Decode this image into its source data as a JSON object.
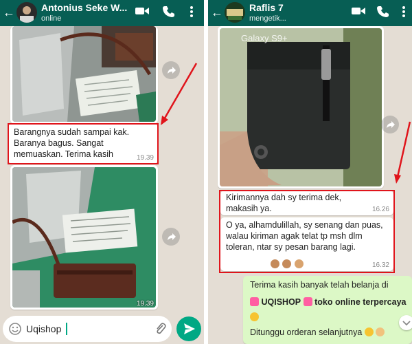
{
  "left_chat": {
    "contact_name": "Antonius Seke W...",
    "status": "online",
    "messages": [
      {
        "type": "image",
        "time": ""
      },
      {
        "type": "text",
        "text": "Barangnya sudah sampai kak. Baranya bagus. Sangat memuaskan. Terima kasih",
        "time": "19.39"
      },
      {
        "type": "image",
        "time": "19.39"
      }
    ],
    "composer_value": "Uqishop"
  },
  "right_chat": {
    "contact_name": "Raflis 7",
    "status": "mengetik...",
    "photo_watermark": "Galaxy S9+",
    "messages": [
      {
        "type": "image",
        "time": ""
      },
      {
        "type": "text",
        "text": "Kirimannya dah sy terima dek, makasih ya.",
        "time": "16.26"
      },
      {
        "type": "text",
        "text": "O ya, alhamdulillah, sy senang dan puas, walau kiriman agak telat tp msh dlm toleran, ntar sy pesan  barang lagi.",
        "time": "16.32"
      },
      {
        "type": "text_out",
        "line1": "Terima kasih banyak telah belanja di",
        "brand": "UQISHOP",
        "tagline": "toko online terpercaya",
        "line3": "Ditunggu orderan selanjutnya"
      }
    ]
  },
  "colors": {
    "header": "#075e54",
    "accent": "#00a884",
    "annotation_red": "#e0141b",
    "outgoing_bubble": "#dcf8c6",
    "chat_background": "#e4ddd4"
  },
  "icons": [
    "back-arrow-icon",
    "video-call-icon",
    "phone-icon",
    "menu-dots-icon",
    "forward-icon",
    "emoji-icon",
    "attachment-icon",
    "send-icon"
  ]
}
